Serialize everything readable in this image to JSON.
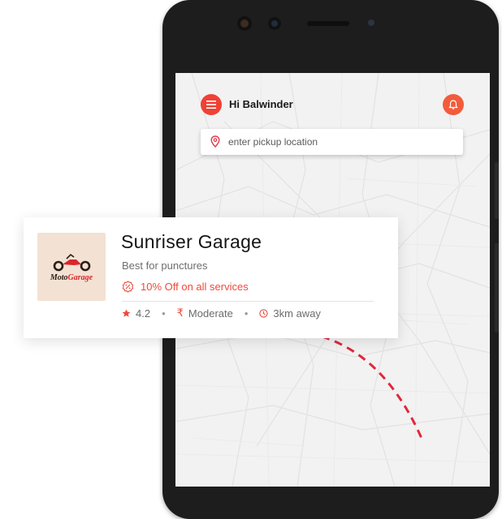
{
  "header": {
    "greeting": "Hi Balwinder",
    "menu_icon": "hamburger-menu-icon",
    "notification_icon": "bell-icon"
  },
  "search": {
    "placeholder": "enter pickup location",
    "icon": "location-pin-icon"
  },
  "garage_card": {
    "name": "Sunriser Garage",
    "tagline": "Best for punctures",
    "offer": "10% Off on all services",
    "rating": "4.2",
    "price_symbol": "₹",
    "price_level": "Moderate",
    "distance": "3km away",
    "logo_text": "MotoGarage",
    "icons": {
      "offer": "discount-badge-icon",
      "rating": "star-icon",
      "distance": "clock-icon"
    }
  },
  "colors": {
    "accent_red": "#ef4135",
    "accent_orange": "#f25c3b",
    "logo_background": "#f3e1d3",
    "route_dashes": "#e0283c"
  }
}
